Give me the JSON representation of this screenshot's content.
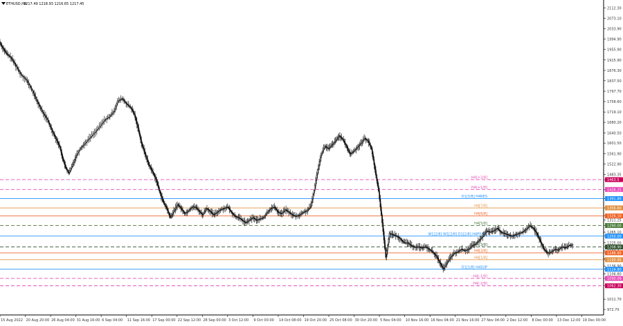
{
  "header": {
    "symbol_label": "ETHUSD,H4",
    "ohlc": "1217.49 1218.93 1216.65 1217.45",
    "arrow_icon": "triangle-down-icon"
  },
  "chart_data": {
    "type": "candlestick",
    "symbol": "ETHUSD",
    "timeframe": "H4",
    "ylim": [
      952.0,
      2132.0
    ],
    "price_axis_ticks": [
      "2112.30",
      "2073.10",
      "2033.90",
      "1994.90",
      "1955.90",
      "1915.90",
      "1876.30",
      "1837.50",
      "1797.70",
      "1758.60",
      "1719.10",
      "1680.20",
      "1640.50",
      "1601.50",
      "1561.90",
      "1522.90",
      "1483.35",
      "1463.5",
      "1426.25",
      "1391.80",
      "1356.60",
      "1326.10",
      "1311.25",
      "1290.00",
      "1265.10",
      "1250.00",
      "1225.00",
      "1208.90",
      "1194.3",
      "1186.90",
      "1165.40",
      "1160.90",
      "1136.90",
      "1124.80",
      "1106.80",
      "1090.09",
      "1062.30",
      "1011.70",
      "972.70"
    ],
    "time_axis_labels": [
      "15 Aug 2022",
      "20 Aug 20:00",
      "26 Aug 04:00",
      "31 Aug 16:00",
      "6 Sep 04:00",
      "11 Sep 16:00",
      "17 Sep 00:00",
      "22 Sep 12:00",
      "28 Sep 00:00",
      "3 Oct 12:00",
      "9 Oct 00:00",
      "14 Oct 08:00",
      "19 Oct 20:00",
      "25 Oct 08:00",
      "30 Oct 20:00",
      "5 Nov 04:00",
      "10 Nov 16:00",
      "16 Nov 04:00",
      "21 Nov 16:00",
      "27 Nov 04:00",
      "2 Dec 12:00",
      "8 Dec 00:00",
      "13 Dec 12:00",
      "19 Dec 00:00"
    ],
    "price_path": [
      [
        0,
        1985
      ],
      [
        0.5,
        1960
      ],
      [
        1.0,
        1940
      ],
      [
        1.6,
        1925
      ],
      [
        2.2,
        1900
      ],
      [
        3.0,
        1862
      ],
      [
        3.8,
        1840
      ],
      [
        4.6,
        1800
      ],
      [
        5.3,
        1758
      ],
      [
        6.0,
        1720
      ],
      [
        6.7,
        1690
      ],
      [
        7.3,
        1652
      ],
      [
        7.9,
        1618
      ],
      [
        8.4,
        1588
      ],
      [
        8.8,
        1545
      ],
      [
        9.2,
        1510
      ],
      [
        9.7,
        1488
      ],
      [
        10.2,
        1520
      ],
      [
        10.7,
        1555
      ],
      [
        11.3,
        1582
      ],
      [
        11.9,
        1600
      ],
      [
        12.6,
        1622
      ],
      [
        13.3,
        1642
      ],
      [
        14.0,
        1665
      ],
      [
        14.7,
        1690
      ],
      [
        15.3,
        1700
      ],
      [
        15.9,
        1720
      ],
      [
        16.5,
        1760
      ],
      [
        17.1,
        1770
      ],
      [
        17.7,
        1750
      ],
      [
        18.3,
        1735
      ],
      [
        18.8,
        1710
      ],
      [
        19.3,
        1660
      ],
      [
        19.8,
        1600
      ],
      [
        20.3,
        1560
      ],
      [
        20.8,
        1520
      ],
      [
        21.3,
        1495
      ],
      [
        21.8,
        1465
      ],
      [
        22.3,
        1420
      ],
      [
        22.8,
        1380
      ],
      [
        23.3,
        1355
      ],
      [
        23.8,
        1320
      ],
      [
        24.3,
        1345
      ],
      [
        24.8,
        1370
      ],
      [
        25.3,
        1355
      ],
      [
        25.8,
        1335
      ],
      [
        26.3,
        1345
      ],
      [
        26.8,
        1360
      ],
      [
        27.3,
        1360
      ],
      [
        27.8,
        1345
      ],
      [
        28.3,
        1330
      ],
      [
        28.8,
        1355
      ],
      [
        29.3,
        1345
      ],
      [
        29.8,
        1330
      ],
      [
        30.3,
        1340
      ],
      [
        30.8,
        1350
      ],
      [
        31.3,
        1355
      ],
      [
        31.8,
        1360
      ],
      [
        32.3,
        1340
      ],
      [
        32.8,
        1325
      ],
      [
        33.3,
        1320
      ],
      [
        33.8,
        1310
      ],
      [
        34.3,
        1300
      ],
      [
        34.8,
        1310
      ],
      [
        35.3,
        1320
      ],
      [
        35.8,
        1310
      ],
      [
        36.3,
        1315
      ],
      [
        36.8,
        1320
      ],
      [
        37.3,
        1340
      ],
      [
        37.8,
        1355
      ],
      [
        38.3,
        1360
      ],
      [
        38.8,
        1340
      ],
      [
        39.3,
        1335
      ],
      [
        39.8,
        1350
      ],
      [
        40.3,
        1340
      ],
      [
        40.8,
        1330
      ],
      [
        41.3,
        1325
      ],
      [
        41.8,
        1330
      ],
      [
        42.3,
        1340
      ],
      [
        42.8,
        1345
      ],
      [
        43.3,
        1360
      ],
      [
        43.8,
        1420
      ],
      [
        44.3,
        1500
      ],
      [
        44.8,
        1560
      ],
      [
        45.3,
        1590
      ],
      [
        45.8,
        1580
      ],
      [
        46.3,
        1595
      ],
      [
        46.8,
        1610
      ],
      [
        47.3,
        1630
      ],
      [
        47.8,
        1615
      ],
      [
        48.3,
        1590
      ],
      [
        48.8,
        1560
      ],
      [
        49.3,
        1570
      ],
      [
        49.8,
        1585
      ],
      [
        50.3,
        1600
      ],
      [
        50.8,
        1620
      ],
      [
        51.3,
        1610
      ],
      [
        51.8,
        1580
      ],
      [
        52.3,
        1500
      ],
      [
        52.8,
        1420
      ],
      [
        53.3,
        1300
      ],
      [
        53.8,
        1170
      ],
      [
        54.3,
        1260
      ],
      [
        54.8,
        1255
      ],
      [
        55.3,
        1250
      ],
      [
        55.8,
        1240
      ],
      [
        56.3,
        1225
      ],
      [
        56.8,
        1225
      ],
      [
        57.3,
        1215
      ],
      [
        57.8,
        1208
      ],
      [
        58.3,
        1210
      ],
      [
        58.8,
        1205
      ],
      [
        59.3,
        1210
      ],
      [
        59.8,
        1200
      ],
      [
        60.3,
        1190
      ],
      [
        60.8,
        1175
      ],
      [
        61.3,
        1150
      ],
      [
        61.8,
        1125
      ],
      [
        62.3,
        1150
      ],
      [
        62.8,
        1170
      ],
      [
        63.3,
        1185
      ],
      [
        63.8,
        1190
      ],
      [
        64.3,
        1200
      ],
      [
        64.8,
        1195
      ],
      [
        65.3,
        1200
      ],
      [
        65.8,
        1215
      ],
      [
        66.3,
        1220
      ],
      [
        66.8,
        1235
      ],
      [
        67.3,
        1250
      ],
      [
        67.8,
        1270
      ],
      [
        68.3,
        1265
      ],
      [
        68.8,
        1270
      ],
      [
        69.3,
        1280
      ],
      [
        69.8,
        1265
      ],
      [
        70.3,
        1260
      ],
      [
        70.8,
        1255
      ],
      [
        71.3,
        1250
      ],
      [
        71.8,
        1255
      ],
      [
        72.3,
        1260
      ],
      [
        72.8,
        1265
      ],
      [
        73.3,
        1275
      ],
      [
        73.8,
        1290
      ],
      [
        74.3,
        1280
      ],
      [
        74.8,
        1260
      ],
      [
        75.3,
        1230
      ],
      [
        75.8,
        1200
      ],
      [
        76.3,
        1185
      ],
      [
        76.8,
        1190
      ],
      [
        77.3,
        1200
      ],
      [
        77.8,
        1198
      ],
      [
        78.3,
        1210
      ],
      [
        78.8,
        1205
      ],
      [
        79.3,
        1215
      ],
      [
        79.8,
        1217
      ]
    ],
    "price_markers": [
      {
        "value": "1463.5",
        "color": "#c8005a"
      },
      {
        "value": "1426.25",
        "color": "#e64ab6"
      },
      {
        "value": "1391.80",
        "color": "#1e90ff"
      },
      {
        "value": "1356.60",
        "color": "#e09040"
      },
      {
        "value": "1326.10",
        "color": "#ef6020"
      },
      {
        "value": "1290.00",
        "color": "#4c7a3a"
      },
      {
        "value": "1250.00",
        "color": "#1e90ff"
      },
      {
        "value": "1208.90",
        "color": "#2f4f2f"
      },
      {
        "value": "1186.90",
        "color": "#ef6020"
      },
      {
        "value": "1160.90",
        "color": "#e09040"
      },
      {
        "value": "1124.80",
        "color": "#1e90ff"
      },
      {
        "value": "1090.09",
        "color": "#e64ab6"
      },
      {
        "value": "1062.30",
        "color": "#c8005a"
      }
    ],
    "levels": [
      {
        "label": "H4[+2/8]",
        "price": 1463.5,
        "color": "#e64ab6",
        "style": "dashed"
      },
      {
        "label": "H4[+1/8]",
        "price": 1426.25,
        "color": "#e64ab6",
        "style": "dashed"
      },
      {
        "label": "D1[3/8] H4RES",
        "price": 1391.8,
        "color": "#1e90ff",
        "style": "solid"
      },
      {
        "label": "H4[7/8]",
        "price": 1356.6,
        "color": "#e09040",
        "style": "solid"
      },
      {
        "label": "H4[6/8]",
        "price": 1326.1,
        "color": "#ef6020",
        "style": "solid"
      },
      {
        "label": "H4[5/8]",
        "price": 1290.0,
        "color": "#4c7a3a",
        "style": "dashed"
      },
      {
        "label": "W1[2/8] W1[2/8] D1[2/8] H4PIVOT",
        "price": 1250.0,
        "color": "#1e90ff",
        "style": "solid"
      },
      {
        "label": "H4[3/8]",
        "price": 1208.9,
        "color": "#2f4f2f",
        "style": "dashed"
      },
      {
        "label": "H4[2/8]",
        "price": 1186.9,
        "color": "#ef6020",
        "style": "solid"
      },
      {
        "label": "H4[1/8]",
        "price": 1160.9,
        "color": "#e09040",
        "style": "solid"
      },
      {
        "label": "D1[1/8] H4SUP",
        "price": 1124.8,
        "color": "#1e90ff",
        "style": "solid"
      },
      {
        "label": "H4[-1/8]",
        "price": 1090.09,
        "color": "#e64ab6",
        "style": "dashed"
      },
      {
        "label": "H4[-2/8]",
        "price": 1062.3,
        "color": "#e64ab6",
        "style": "dashed"
      }
    ]
  }
}
